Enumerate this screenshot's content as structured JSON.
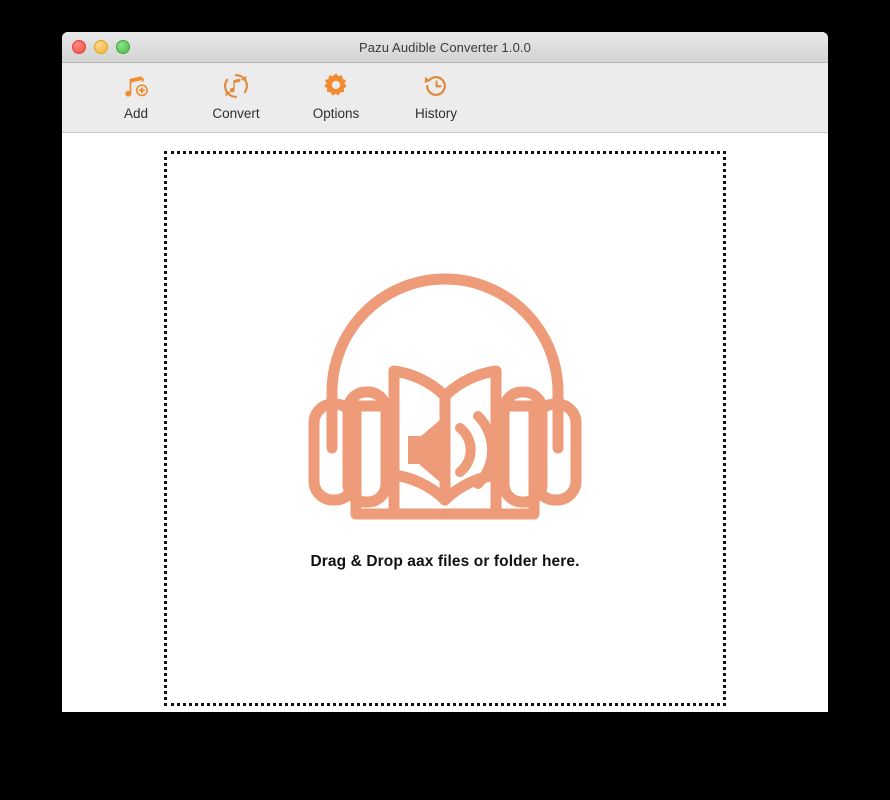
{
  "window": {
    "title": "Pazu Audible Converter 1.0.0",
    "controls": [
      {
        "name": "close",
        "color": "#ef5f56"
      },
      {
        "name": "minimize",
        "color": "#f5bd4f"
      },
      {
        "name": "zoom",
        "color": "#5dc75a"
      }
    ]
  },
  "toolbar": {
    "accent_color": "#f28b30",
    "background": "#ececec",
    "items": [
      {
        "label": "Add",
        "icon": "music-note-plus-icon"
      },
      {
        "label": "Convert",
        "icon": "convert-refresh-note-icon"
      },
      {
        "label": "Options",
        "icon": "gear-icon"
      },
      {
        "label": "History",
        "icon": "clock-history-icon"
      }
    ]
  },
  "drop_zone": {
    "message": "Drag & Drop aax files or folder here.",
    "illustration": "audiobook-headphones-book-icon",
    "illustration_color": "#ed9b78",
    "border_style": "dotted",
    "border_color": "#111111"
  }
}
